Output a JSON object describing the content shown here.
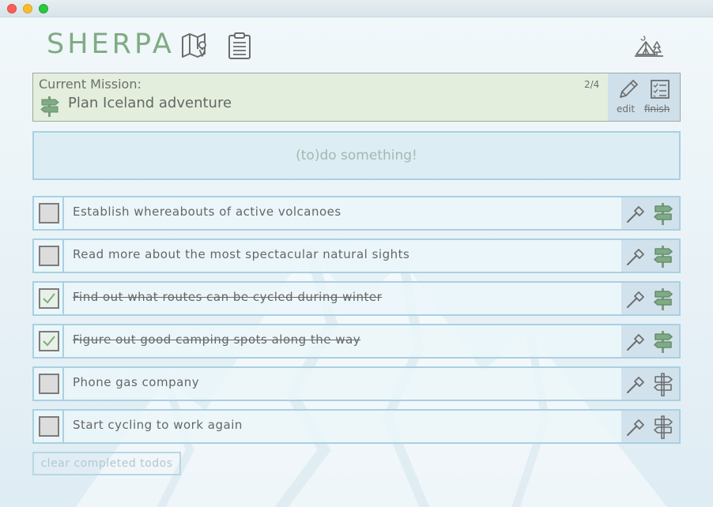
{
  "app": {
    "name": "SHERPA"
  },
  "colors": {
    "brand_green": "#7fab84",
    "border_blue": "#a9d0e2",
    "mission_bg": "#e3eedd",
    "tool_bg": "#d1e2ec"
  },
  "header": {
    "icons": [
      "map-pin-icon",
      "clipboard-icon",
      "campsite-icon"
    ]
  },
  "mission": {
    "label": "Current Mission:",
    "title": "Plan Iceland adventure",
    "count": "2/4",
    "edit_label": "edit",
    "finish_label": "finish"
  },
  "new_todo": {
    "placeholder": "(to)do something!"
  },
  "todos": [
    {
      "text": "Establish whereabouts of active volcanoes",
      "done": false,
      "sign_filled": true
    },
    {
      "text": "Read more about the most spectacular natural sights",
      "done": false,
      "sign_filled": true
    },
    {
      "text": "Find out what routes can be cycled during winter",
      "done": true,
      "sign_filled": true
    },
    {
      "text": "Figure out good camping spots along the way",
      "done": true,
      "sign_filled": true
    },
    {
      "text": "Phone gas company",
      "done": false,
      "sign_filled": false
    },
    {
      "text": "Start cycling to work again",
      "done": false,
      "sign_filled": false
    }
  ],
  "footer": {
    "clear_label": "clear completed todos"
  }
}
